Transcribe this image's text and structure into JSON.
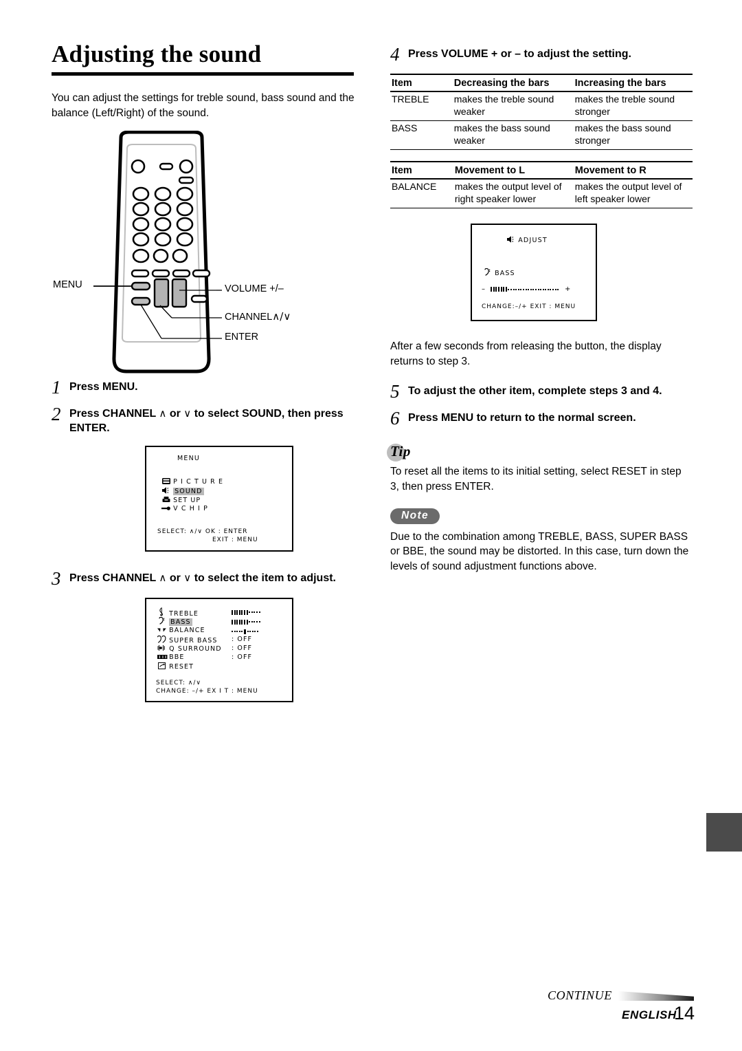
{
  "page": {
    "title": "Adjusting the sound",
    "intro": "You can adjust the settings for treble sound, bass sound and the balance (Left/Right) of the sound.",
    "continue_label": "CONTINUE",
    "language_label": "ENGLISH",
    "page_number": "14"
  },
  "remote": {
    "labels": {
      "menu": "MENU",
      "volume": "VOLUME +/–",
      "channel": "CHANNEL",
      "channel_glyphs": "∧/∨",
      "enter": "ENTER"
    }
  },
  "steps": {
    "s1": {
      "num": "1",
      "text": "Press MENU."
    },
    "s2": {
      "num": "2",
      "text_a": "Press CHANNEL ",
      "glyph_a": "∧",
      "text_b": " or ",
      "glyph_b": "∨",
      "text_c": " to select SOUND, then press ENTER."
    },
    "s3": {
      "num": "3",
      "text_a": "Press CHANNEL ",
      "glyph_a": "∧",
      "text_b": " or ",
      "glyph_b": "∨",
      "text_c": " to select the item to adjust."
    },
    "s4": {
      "num": "4",
      "text": "Press VOLUME + or – to adjust the setting."
    },
    "s5": {
      "num": "5",
      "text": "To adjust the other item, complete steps 3 and 4."
    },
    "s6": {
      "num": "6",
      "text": "Press MENU to return to the normal screen."
    }
  },
  "osd_menu": {
    "title": "MENU",
    "items": [
      {
        "icon": "picture-icon",
        "label": "P I C T U R E",
        "selected": false
      },
      {
        "icon": "speaker-icon",
        "label": "SOUND",
        "selected": true
      },
      {
        "icon": "setup-icon",
        "label": "SET  UP",
        "selected": false
      },
      {
        "icon": "vchip-icon",
        "label": "V  C H I P",
        "selected": false
      }
    ],
    "footer_line1": "SELECT: ∧/∨   OK : ENTER",
    "footer_line2": "EXIT : MENU"
  },
  "osd_sound": {
    "items": [
      {
        "icon": "treble-clef-icon",
        "label": "TREBLE",
        "value_type": "meter",
        "selected": false
      },
      {
        "icon": "bass-clef-icon",
        "label": "BASS",
        "value_type": "meter",
        "selected": true
      },
      {
        "icon": "balance-icon",
        "label": "BALANCE",
        "value_type": "center-meter",
        "selected": false
      },
      {
        "icon": "double-bass-clef-icon",
        "label": "SUPER BASS",
        "value": ": OFF",
        "selected": false
      },
      {
        "icon": "surround-icon",
        "label": "Q SURROUND",
        "value": ": OFF",
        "selected": false
      },
      {
        "icon": "bbe-icon",
        "label": "BBE",
        "value": ": OFF",
        "selected": false
      },
      {
        "icon": "reset-icon",
        "label": "RESET",
        "value": "",
        "selected": false
      }
    ],
    "footer_line1": "SELECT: ∧/∨",
    "footer_line2": "CHANGE: –/+   EX I T : MENU"
  },
  "osd_adjust": {
    "icon": "speaker-icon",
    "title": "ADJUST",
    "item_icon": "bass-clef-icon",
    "item_label": "BASS",
    "minus": "–",
    "plus": "+",
    "footer": "CHANGE:–/+   EXIT : MENU"
  },
  "table_bars": {
    "headers": [
      "Item",
      "Decreasing the bars",
      "Increasing the bars"
    ],
    "rows": [
      {
        "item": "TREBLE",
        "dec": "makes the treble sound weaker",
        "inc": "makes the treble sound stronger"
      },
      {
        "item": "BASS",
        "dec": "makes the bass sound weaker",
        "inc": "makes the bass sound stronger"
      }
    ]
  },
  "table_balance": {
    "headers": [
      "Item",
      "Movement to L",
      "Movement to R"
    ],
    "rows": [
      {
        "item": "BALANCE",
        "dec": "makes the output level of right speaker lower",
        "inc": "makes the output level of left speaker lower"
      }
    ]
  },
  "after_note": "After a few seconds from releasing the button, the display returns to step 3.",
  "tip": {
    "badge": "Tip",
    "text": "To reset all the items to its initial setting, select RESET in step 3, then press ENTER."
  },
  "note": {
    "badge": "Note",
    "text": "Due to the combination among TREBLE, BASS, SUPER BASS or BBE, the sound may be distorted. In this case, turn down the levels of sound adjustment functions above."
  }
}
